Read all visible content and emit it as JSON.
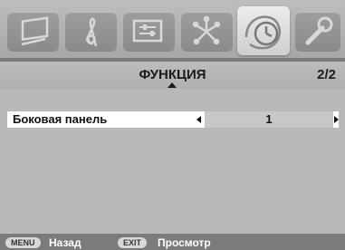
{
  "tabs": [
    {
      "icon": "tv-picture-icon",
      "active": false
    },
    {
      "icon": "music-note-icon",
      "active": false
    },
    {
      "icon": "settings-sliders-icon",
      "active": false
    },
    {
      "icon": "network-icon",
      "active": false
    },
    {
      "icon": "clock-icon",
      "active": true
    },
    {
      "icon": "wrench-icon",
      "active": false
    }
  ],
  "header": {
    "title": "ФУНКЦИЯ",
    "page": "2/2"
  },
  "settings": [
    {
      "label": "Боковая панель",
      "value": "1"
    }
  ],
  "footer": {
    "menu_key": "MENU",
    "menu_label": "Назад",
    "exit_key": "EXIT",
    "exit_label": "Просмотр"
  },
  "colors": {
    "background": "#b9b9b9",
    "selected_row": "#ffffff",
    "footer": "#7b7b7b"
  }
}
